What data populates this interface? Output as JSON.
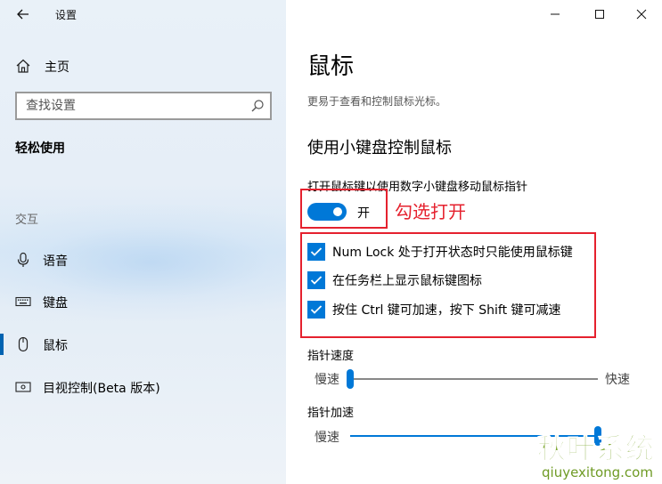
{
  "app": {
    "title": "设置"
  },
  "sidebar": {
    "home_label": "主页",
    "search_placeholder": "查找设置",
    "category": "轻松使用",
    "group": "交互",
    "items": [
      {
        "label": "语音",
        "icon": "microphone-icon"
      },
      {
        "label": "键盘",
        "icon": "keyboard-icon"
      },
      {
        "label": "鼠标",
        "icon": "mouse-icon",
        "selected": true
      },
      {
        "label": "目视控制(Beta 版本)",
        "icon": "eye-control-icon"
      }
    ]
  },
  "window_controls": [
    "minimize-icon",
    "maximize-icon",
    "close-icon"
  ],
  "main": {
    "title": "鼠标",
    "subtitle": "更易于查看和控制鼠标光标。",
    "section_heading": "使用小键盘控制鼠标",
    "toggle_label": "打开鼠标键以使用数字小键盘移动鼠标指针",
    "toggle_state": "开",
    "toggle_on": true,
    "annotation": "勾选打开",
    "checkboxes": [
      {
        "label": "Num Lock 处于打开状态时只能使用鼠标键",
        "checked": true
      },
      {
        "label": "在任务栏上显示鼠标键图标",
        "checked": true
      },
      {
        "label": "按住 Ctrl 键可加速，按下 Shift 键可减速",
        "checked": true
      }
    ],
    "pointer_speed": {
      "label": "指针速度",
      "min_label": "慢速",
      "max_label": "快速",
      "value_fraction": 0.0
    },
    "pointer_accel": {
      "label": "指针加速",
      "min_label": "慢速",
      "value_fraction": 1.0
    }
  },
  "colors": {
    "accent": "#0078d7",
    "annotation_red": "#e5212e",
    "watermark_green": "#7fa832"
  },
  "watermark": {
    "text_cn": "秋叶系统",
    "text_en": "qiuyexitong.com"
  }
}
